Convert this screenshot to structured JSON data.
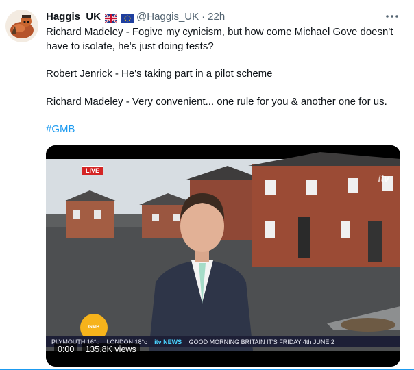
{
  "tweet": {
    "display_name": "Haggis_UK",
    "handle": "@Haggis_UK",
    "separator": "·",
    "time": "22h",
    "paragraphs": [
      "Richard Madeley - Fogive my cynicism, but how come Michael Gove doesn't have to isolate, he's just doing tests?",
      "Robert Jenrick - He's taking part in a pilot scheme",
      "Richard Madeley - Very convenient... one rule for you & another one for us."
    ],
    "hashtag": "#GMB"
  },
  "video": {
    "current_time": "0:00",
    "views": "135.8K views",
    "live_label": "LIVE",
    "logo": "GMB",
    "itv_mark": "itv",
    "ticker_weather_1": "PLYMOUTH 16°c",
    "ticker_weather_2": "LONDON 18°c",
    "ticker_brand": "itv NEWS",
    "ticker_headline": "GOOD MORNING BRITAIN IT'S FRIDAY 4th JUNE 2"
  },
  "icons": {
    "more": "more-icon",
    "uk_flag": "uk-flag-icon",
    "eu_flag": "eu-flag-icon"
  },
  "colors": {
    "hashtag": "#1d9bf0",
    "secondary_text": "#536471"
  }
}
